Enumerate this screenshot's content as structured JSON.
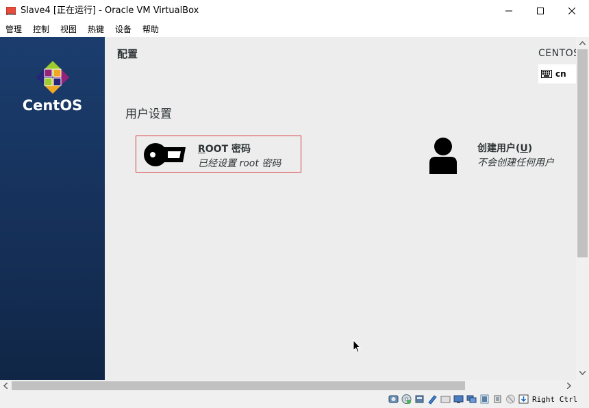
{
  "window": {
    "title": "Slave4 [正在运行] - Oracle VM VirtualBox",
    "minimize": "—",
    "maximize": "☐",
    "close": "✕"
  },
  "menu": [
    "管理",
    "控制",
    "视图",
    "热键",
    "设备",
    "帮助"
  ],
  "installer": {
    "logo_text": "CentOS",
    "page_title": "配置",
    "distro_label": "CENTOS",
    "keyboard_layout": "cn",
    "section_title": "用户设置",
    "root_spoke": {
      "mnemonic": "R",
      "name_rest": "OOT 密码",
      "status": "已经设置 root 密码"
    },
    "user_spoke": {
      "name_prefix": "创建用户(",
      "mnemonic": "U",
      "name_suffix": ")",
      "status": "不会创建任何用户"
    }
  },
  "statusbar": {
    "host_key": "Right Ctrl",
    "icons": [
      "hard-disk-icon",
      "optical-drive-icon",
      "audio-icon",
      "network-icon",
      "usb-icon",
      "shared-folder-icon",
      "display-icon",
      "video-capture-icon",
      "cpu-icon",
      "mouse-integration-icon",
      "keyboard-capture-icon"
    ]
  },
  "colors": {
    "sidebar_top": "#1b3d6e",
    "sidebar_bottom": "#102646",
    "highlight_border": "#d63a3a",
    "content_bg": "#ededed"
  }
}
